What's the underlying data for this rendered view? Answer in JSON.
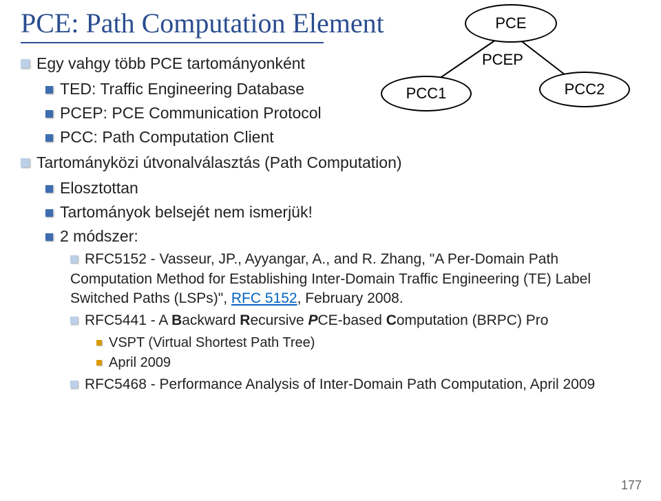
{
  "title": "PCE: Path Computation Element",
  "diagram": {
    "pce": "PCE",
    "pcep": "PCEP",
    "pcc1": "PCC1",
    "pcc2": "PCC2"
  },
  "bullets": {
    "b1": "Egy vahgy több PCE tartományonként",
    "b1a": "TED: Traffic Engineering Database",
    "b1b": "PCEP: PCE Communication Protocol",
    "b1c": "PCC: Path Computation Client",
    "b2": "Tartományközi útvonalválasztás (Path Computation)",
    "b2a": "Elosztottan",
    "b2b": "Tartományok belsejét nem ismerjük!",
    "b2c": "2 módszer:",
    "rfc5152_pre": "RFC5152 - Vasseur, JP., Ayyangar, A., and R. Zhang, \"A Per-Domain Path Computation Method for Establishing Inter-Domain Traffic Engineering (TE) Label Switched Paths (LSPs)\", ",
    "rfc5152_link": "RFC 5152",
    "rfc5152_post": ", February 2008.",
    "rfc5441_pre": "RFC5441 - A ",
    "rfc5441_b": "B",
    "rfc5441_t1": "ackward ",
    "rfc5441_r": "R",
    "rfc5441_t2": "ecursive ",
    "rfc5441_p": "P",
    "rfc5441_t3": "CE-based ",
    "rfc5441_c": "C",
    "rfc5441_t4": "omputation (BRPC) Pro",
    "vspt": "VSPT (Virtual Shortest Path Tree)",
    "apr2009": "April 2009",
    "rfc5468": "RFC5468 - Performance Analysis of Inter-Domain Path Computation, April 2009"
  },
  "pagenum": "177"
}
